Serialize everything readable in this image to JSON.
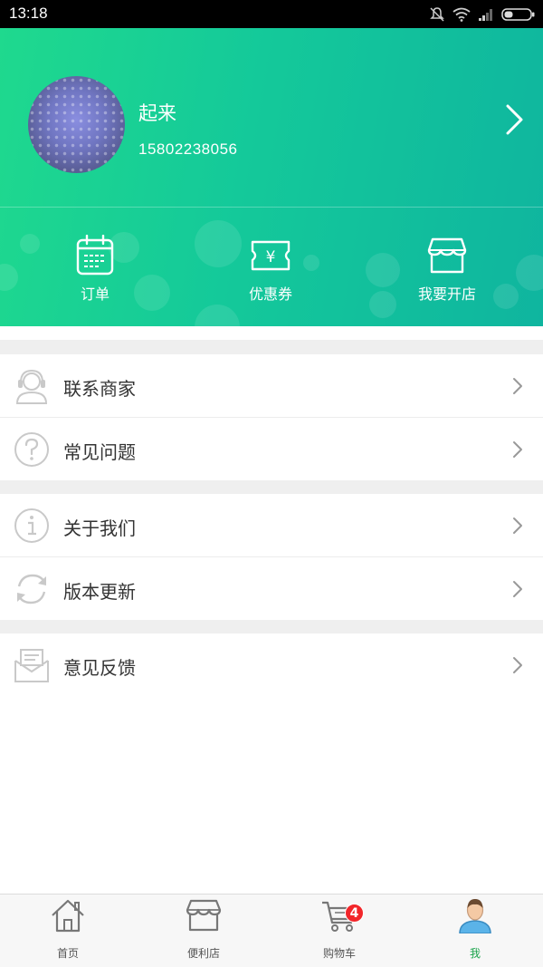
{
  "status_bar": {
    "time": "13:18"
  },
  "profile": {
    "name": "起来",
    "phone": "15802238056"
  },
  "quick_actions": [
    {
      "label": "订单",
      "icon": "calendar-order-icon"
    },
    {
      "label": "优惠券",
      "icon": "coupon-icon"
    },
    {
      "label": "我要开店",
      "icon": "store-icon"
    }
  ],
  "menu": {
    "contact_merchant": "联系商家",
    "faq": "常见问题",
    "about_us": "关于我们",
    "version_update": "版本更新",
    "feedback": "意见反馈"
  },
  "tabs": [
    {
      "label": "首页",
      "icon": "home-icon"
    },
    {
      "label": "便利店",
      "icon": "store-icon"
    },
    {
      "label": "购物车",
      "icon": "cart-icon",
      "badge": "4"
    },
    {
      "label": "我",
      "icon": "user-icon",
      "active": true
    }
  ],
  "colors": {
    "accent": "#1cd18f",
    "active_tab": "#1aa34a",
    "badge": "#f2262a"
  }
}
